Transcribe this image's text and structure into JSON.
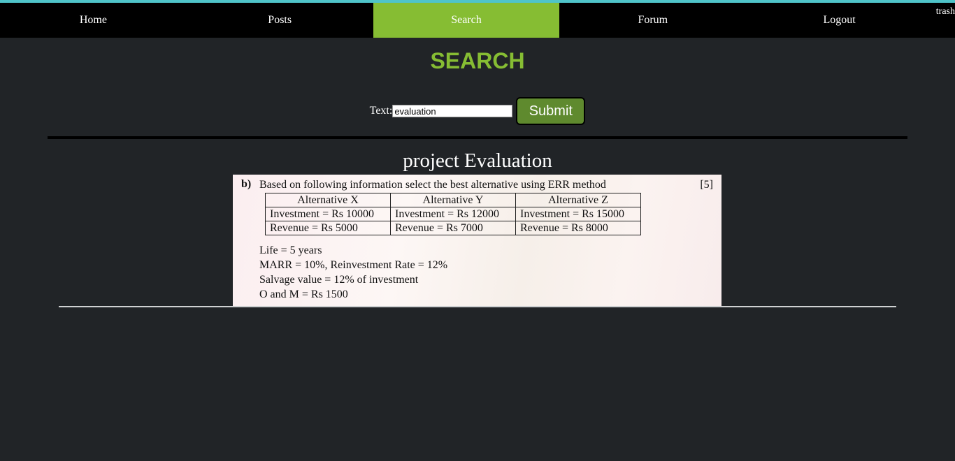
{
  "nav": {
    "items": [
      {
        "label": "Home"
      },
      {
        "label": "Posts"
      },
      {
        "label": "Search"
      },
      {
        "label": "Forum"
      },
      {
        "label": "Logout"
      }
    ],
    "active": "Search",
    "username": "trash"
  },
  "page": {
    "title": "SEARCH"
  },
  "search": {
    "label": "Text:",
    "value": "evaluation",
    "submit_label": "Submit"
  },
  "result": {
    "title": "project Evaluation",
    "image": {
      "question_label": "b)",
      "question_text": "Based on following information select the best alternative using ERR method",
      "marks": "[5]",
      "table": {
        "headers": [
          "Alternative X",
          "Alternative Y",
          "Alternative Z"
        ],
        "rows": [
          [
            "Investment = Rs 10000",
            "Investment = Rs 12000",
            "Investment = Rs 15000"
          ],
          [
            "Revenue = Rs 5000",
            "Revenue = Rs 7000",
            "Revenue = Rs 8000"
          ]
        ]
      },
      "lines": [
        "Life = 5 years",
        "MARR = 10%, Reinvestment Rate = 12%",
        "Salvage value = 12% of investment",
        "O and M = Rs 1500"
      ]
    }
  },
  "colors": {
    "accent": "#86bd33",
    "background": "#212427",
    "navbar": "#000000",
    "top_strip": "#4fc4c9",
    "submit_button": "#5f8a2e"
  }
}
